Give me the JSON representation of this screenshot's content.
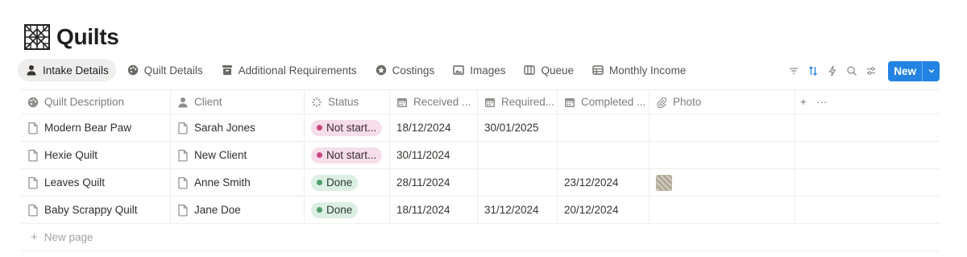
{
  "page": {
    "title": "Quilts",
    "icon": "quilt-block-icon"
  },
  "tabs": [
    {
      "label": "Intake Details",
      "icon": "person-icon",
      "active": true
    },
    {
      "label": "Quilt Details",
      "icon": "palette-icon",
      "active": false
    },
    {
      "label": "Additional Requirements",
      "icon": "inbox-icon",
      "active": false
    },
    {
      "label": "Costings",
      "icon": "badge-icon",
      "active": false
    },
    {
      "label": "Images",
      "icon": "image-icon",
      "active": false
    },
    {
      "label": "Queue",
      "icon": "board-icon",
      "active": false
    },
    {
      "label": "Monthly Income",
      "icon": "table-icon",
      "active": false
    }
  ],
  "toolbar": {
    "icons": [
      "filter-icon",
      "sort-icon",
      "automation-icon",
      "search-icon",
      "settings-icon"
    ],
    "new_label": "New",
    "accent": "#2383e2"
  },
  "table": {
    "columns": [
      {
        "label": "Quilt Description",
        "icon": "palette-icon"
      },
      {
        "label": "Client",
        "icon": "person-icon"
      },
      {
        "label": "Status",
        "icon": "status-icon"
      },
      {
        "label": "Received ...",
        "icon": "calendar-icon"
      },
      {
        "label": "Required...",
        "icon": "calendar-icon"
      },
      {
        "label": "Completed ...",
        "icon": "calendar-icon"
      },
      {
        "label": "Photo",
        "icon": "paperclip-icon"
      }
    ],
    "rows": [
      {
        "description": "Modern Bear Paw",
        "client": "Sarah Jones",
        "status": "Not start...",
        "status_kind": "notstarted",
        "received": "18/12/2024",
        "required": "30/01/2025",
        "completed": "",
        "photo": false
      },
      {
        "description": "Hexie Quilt",
        "client": "New Client",
        "status": "Not start...",
        "status_kind": "notstarted",
        "received": "30/11/2024",
        "required": "",
        "completed": "",
        "photo": false
      },
      {
        "description": "Leaves Quilt",
        "client": "Anne Smith",
        "status": "Done",
        "status_kind": "done",
        "received": "28/11/2024",
        "required": "",
        "completed": "23/12/2024",
        "photo": true
      },
      {
        "description": "Baby Scrappy Quilt",
        "client": "Jane Doe",
        "status": "Done",
        "status_kind": "done",
        "received": "18/11/2024",
        "required": "31/12/2024",
        "completed": "20/12/2024",
        "photo": false
      }
    ],
    "add_column_symbol": "+",
    "more_symbol": "···",
    "new_page_label": "New page"
  },
  "colors": {
    "not_started_bg": "#f6dde9",
    "not_started_dot": "#c7457f",
    "done_bg": "#dcefe3",
    "done_dot": "#4d9e6b"
  }
}
